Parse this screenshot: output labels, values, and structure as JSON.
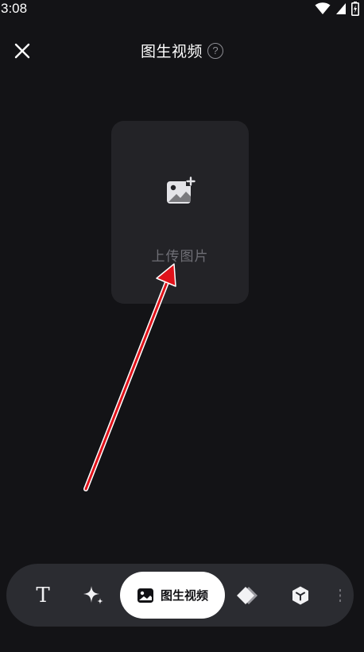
{
  "status_bar": {
    "time": "3:08",
    "icons": [
      "wifi-icon",
      "signal-icon",
      "battery-icon"
    ]
  },
  "header": {
    "close_icon": "close-icon",
    "title": "图生视频",
    "help_symbol": "?"
  },
  "upload_card": {
    "icon": "add-image-icon",
    "label": "上传图片"
  },
  "toolbar": {
    "items": [
      {
        "icon": "text-icon",
        "glyph": "T",
        "active": false
      },
      {
        "icon": "sparkle-icon",
        "active": false
      },
      {
        "icon": "image-icon",
        "label": "图生视频",
        "active": true
      },
      {
        "icon": "diamond-layers-icon",
        "active": false
      },
      {
        "icon": "cube-icon",
        "active": false
      },
      {
        "icon": "more-icon",
        "active": false
      }
    ]
  },
  "colors": {
    "background": "#131316",
    "card": "#232327",
    "toolbar": "#2b2c31",
    "active_pill": "#ffffff",
    "annotation_arrow": "#e0121a"
  }
}
